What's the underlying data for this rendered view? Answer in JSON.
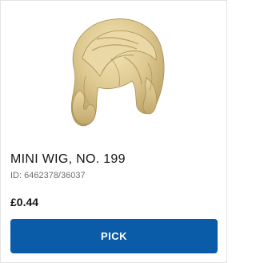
{
  "product": {
    "image_icon": "wig-product-image",
    "name": "MINI WIG, NO. 199",
    "id_text": "ID: 6462378/36037",
    "price": "£0.44",
    "pick_label": "PICK",
    "colors": {
      "wig_tan": "#d8c48c",
      "button_blue": "#0b5ca8"
    }
  }
}
